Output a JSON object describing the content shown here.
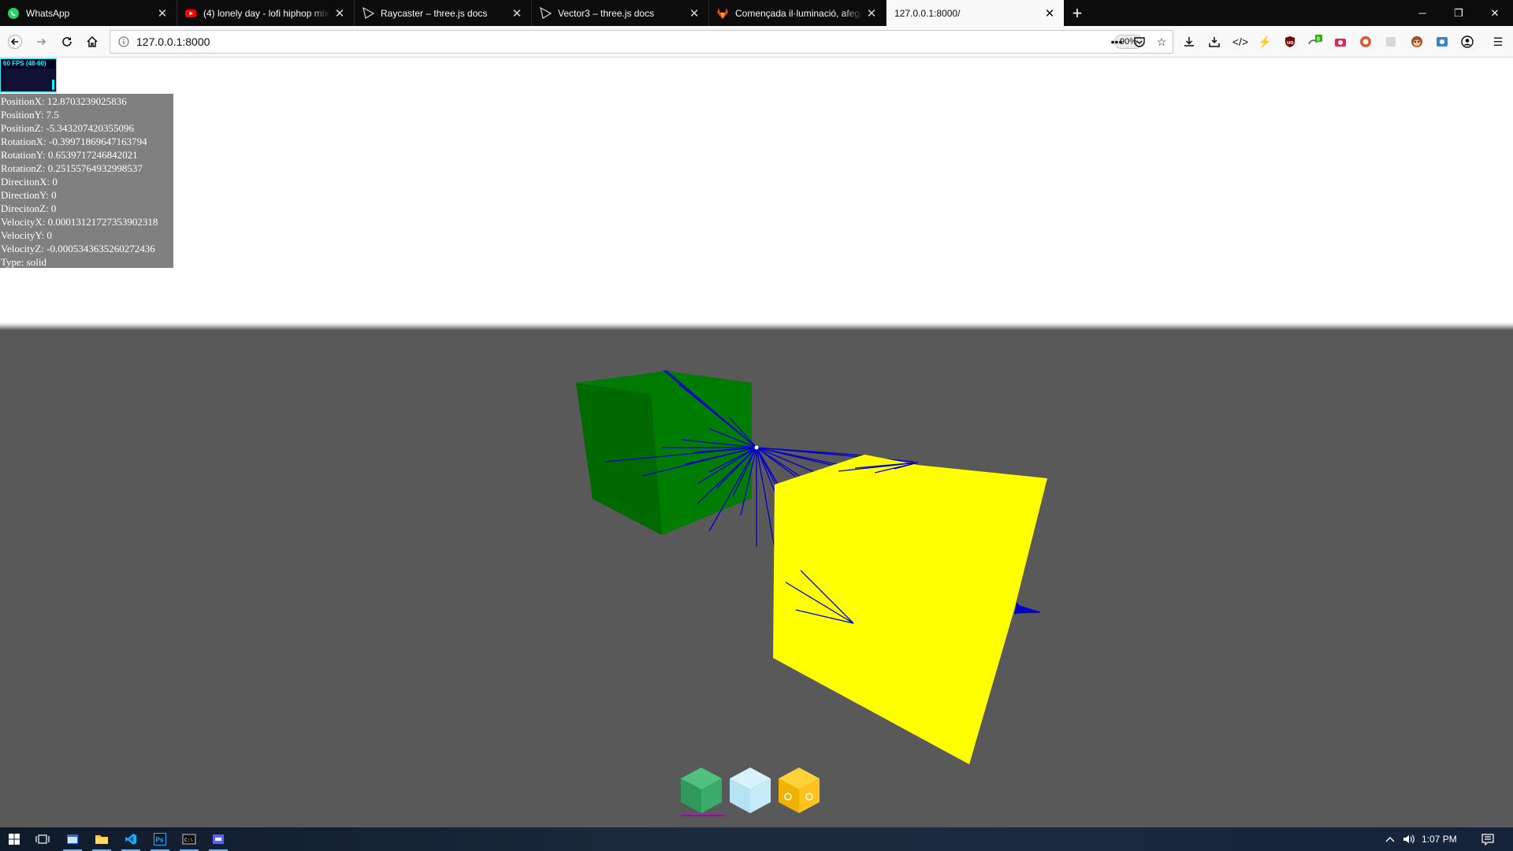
{
  "browser": {
    "tabs": [
      {
        "label": "WhatsApp",
        "icon": "whatsapp-icon",
        "color": "#25d366"
      },
      {
        "label": "(4) lonely day - lofi hiphop mix",
        "icon": "youtube-icon",
        "color": "#ff0000"
      },
      {
        "label": "Raycaster – three.js docs",
        "icon": "threejs-icon",
        "color": "#ffffff"
      },
      {
        "label": "Vector3 – three.js docs",
        "icon": "threejs-icon",
        "color": "#ffffff"
      },
      {
        "label": "Començada il·luminació, afegit",
        "icon": "gitlab-icon",
        "color": "#e24329"
      },
      {
        "label": "127.0.0.1:8000/",
        "icon": "none",
        "active": true
      }
    ],
    "url": "127.0.0.1:8000",
    "zoom": "90%"
  },
  "page": {
    "fps_label": "60 FPS (48-60)",
    "fps_level": 0.5,
    "info": [
      "PositionX: 12.8703239025836",
      "PositionY: 7.5",
      "PositionZ: -5.343207420355096",
      "RotationX: -0.39971869647163794",
      "RotationY: 0.6539717246842021",
      "RotationZ: 0.25155764932998537",
      "DirecitonX: 0",
      "DirectionY: 0",
      "DirecitonZ: 0",
      "VelocityX: 0.00013121727353902318",
      "VelocityY: 0",
      "VelocityZ: -0.0005343635260272436",
      "Type: solid"
    ],
    "hotbar": [
      {
        "name": "grass-block",
        "selected": true
      },
      {
        "name": "ice-block",
        "selected": false
      },
      {
        "name": "gold-block",
        "selected": false
      }
    ]
  },
  "taskbar": {
    "apps": [
      "start-icon",
      "task-view-icon",
      "file-explorer-icon",
      "folder-icon",
      "vscode-icon",
      "photoshop-icon",
      "terminal-icon",
      "app-icon"
    ],
    "time": "1:07 PM"
  },
  "colors": {
    "sky": "#ffffff",
    "ground": "#595959",
    "green_cube": "#008000",
    "yellow_cube": "#ffff00",
    "rays": "#0000ee"
  }
}
